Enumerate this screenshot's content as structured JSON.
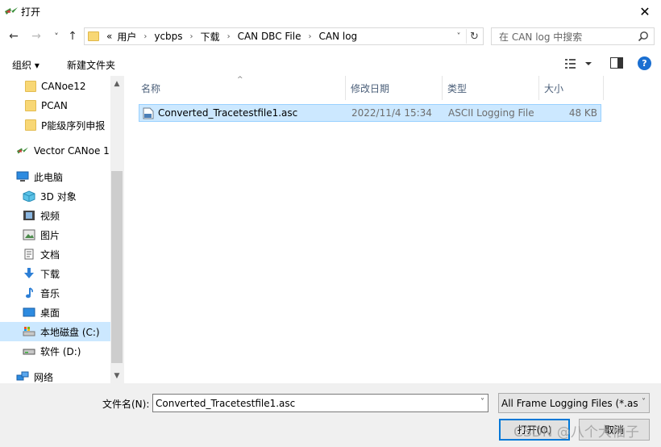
{
  "window": {
    "title": "打开"
  },
  "nav": {
    "back": "←",
    "forward": "→",
    "recent": "˅",
    "up": "↑",
    "breadcrumb": [
      "«",
      "用户",
      "ycbps",
      "下载",
      "CAN DBC File",
      "CAN log"
    ],
    "refresh": "↻",
    "search_placeholder": "在 CAN log 中搜索"
  },
  "toolbar": {
    "organize": "组织 ▾",
    "new_folder": "新建文件夹"
  },
  "sidebar": {
    "items": [
      {
        "label": "CANoe12",
        "icon": "folder-icon"
      },
      {
        "label": "PCAN",
        "icon": "folder-icon"
      },
      {
        "label": "P能级序列申报",
        "icon": "folder-icon"
      },
      {
        "label": "Vector CANoe 1",
        "icon": "vector-app-icon"
      },
      {
        "label": "此电脑",
        "icon": "computer-icon"
      },
      {
        "label": "3D 对象",
        "icon": "3d-objects-icon"
      },
      {
        "label": "视频",
        "icon": "videos-icon"
      },
      {
        "label": "图片",
        "icon": "pictures-icon"
      },
      {
        "label": "文档",
        "icon": "documents-icon"
      },
      {
        "label": "下载",
        "icon": "downloads-icon"
      },
      {
        "label": "音乐",
        "icon": "music-icon"
      },
      {
        "label": "桌面",
        "icon": "desktop-icon"
      },
      {
        "label": "本地磁盘 (C:)",
        "icon": "drive-c-icon",
        "selected": true
      },
      {
        "label": "软件 (D:)",
        "icon": "drive-d-icon"
      },
      {
        "label": "网络",
        "icon": "network-icon"
      }
    ]
  },
  "columns": {
    "name": "名称",
    "modified": "修改日期",
    "type": "类型",
    "size": "大小"
  },
  "files": [
    {
      "name": "Converted_Tracetestfile1.asc",
      "modified": "2022/11/4 15:34",
      "type": "ASCII Logging File",
      "size": "48 KB"
    }
  ],
  "bottom": {
    "filename_label": "文件名(N):",
    "filename_value": "Converted_Tracetestfile1.asc",
    "filter_value": "All Frame Logging Files (*.as",
    "open_label": "打开(O)",
    "cancel_label": "取消"
  },
  "watermark": "CSDN @八个大柚子",
  "colors": {
    "selection": "#cce8ff",
    "selection_border": "#99d1ff",
    "accent": "#0078d7"
  }
}
